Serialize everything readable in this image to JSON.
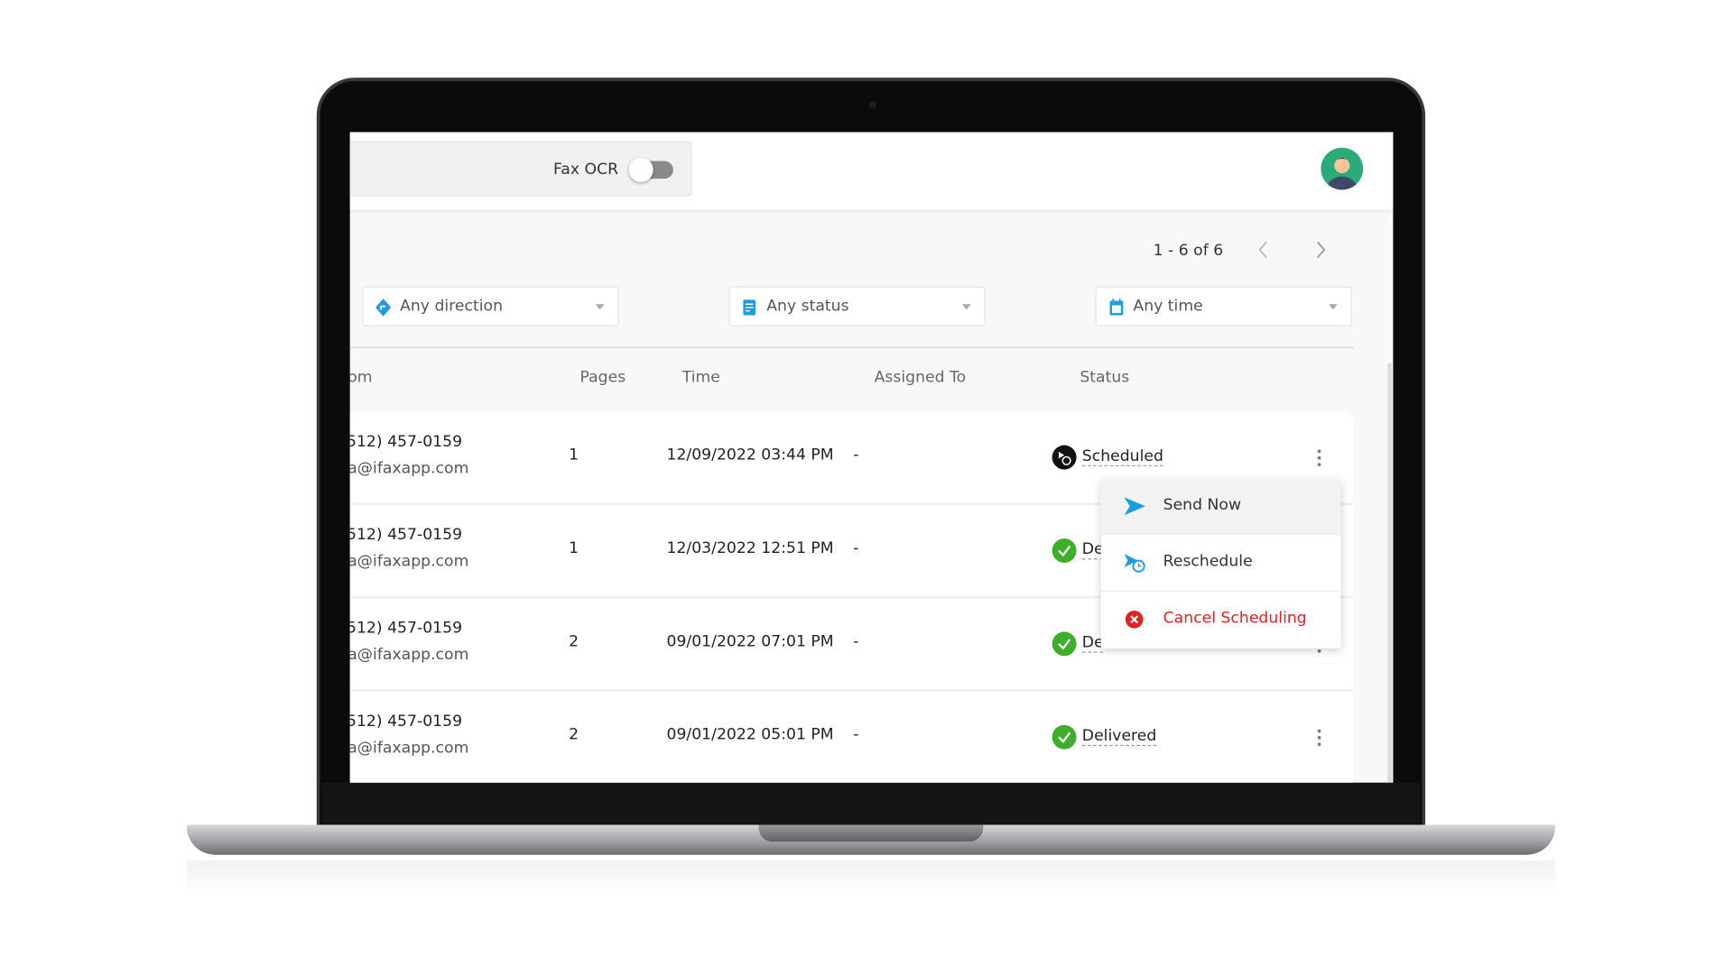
{
  "header": {
    "fax_ocr_label": "Fax OCR",
    "fax_ocr_enabled": false
  },
  "pagination": {
    "range": "1 - 6 of 6"
  },
  "filters": [
    {
      "label": "Any direction",
      "icon": "direction-icon"
    },
    {
      "label": "Any status",
      "icon": "status-icon"
    },
    {
      "label": "Any time",
      "icon": "calendar-icon"
    }
  ],
  "table": {
    "columns": [
      "om",
      "Pages",
      "Time",
      "Assigned To",
      "Status"
    ],
    "rows": [
      {
        "phone": "512) 457-0159",
        "email": "a@ifaxapp.com",
        "pages": "1",
        "time": "12/09/2022 03:44 PM",
        "assigned": "-",
        "status": "Scheduled"
      },
      {
        "phone": "512) 457-0159",
        "email": "a@ifaxapp.com",
        "pages": "1",
        "time": "12/03/2022 12:51 PM",
        "assigned": "-",
        "status": "De"
      },
      {
        "phone": "512) 457-0159",
        "email": "a@ifaxapp.com",
        "pages": "2",
        "time": "09/01/2022 07:01 PM",
        "assigned": "-",
        "status": "De"
      },
      {
        "phone": "512) 457-0159",
        "email": "a@ifaxapp.com",
        "pages": "2",
        "time": "09/01/2022 05:01 PM",
        "assigned": "-",
        "status": "Delivered"
      }
    ]
  },
  "menu": {
    "items": [
      {
        "label": "Send Now",
        "icon": "send-icon"
      },
      {
        "label": "Reschedule",
        "icon": "reschedule-icon"
      },
      {
        "label": "Cancel Scheduling",
        "icon": "cancel-icon",
        "color": "#e8201f"
      }
    ]
  },
  "colors": {
    "accent": "#1a9ee0",
    "success": "#3fae2a",
    "danger": "#e8201f"
  }
}
